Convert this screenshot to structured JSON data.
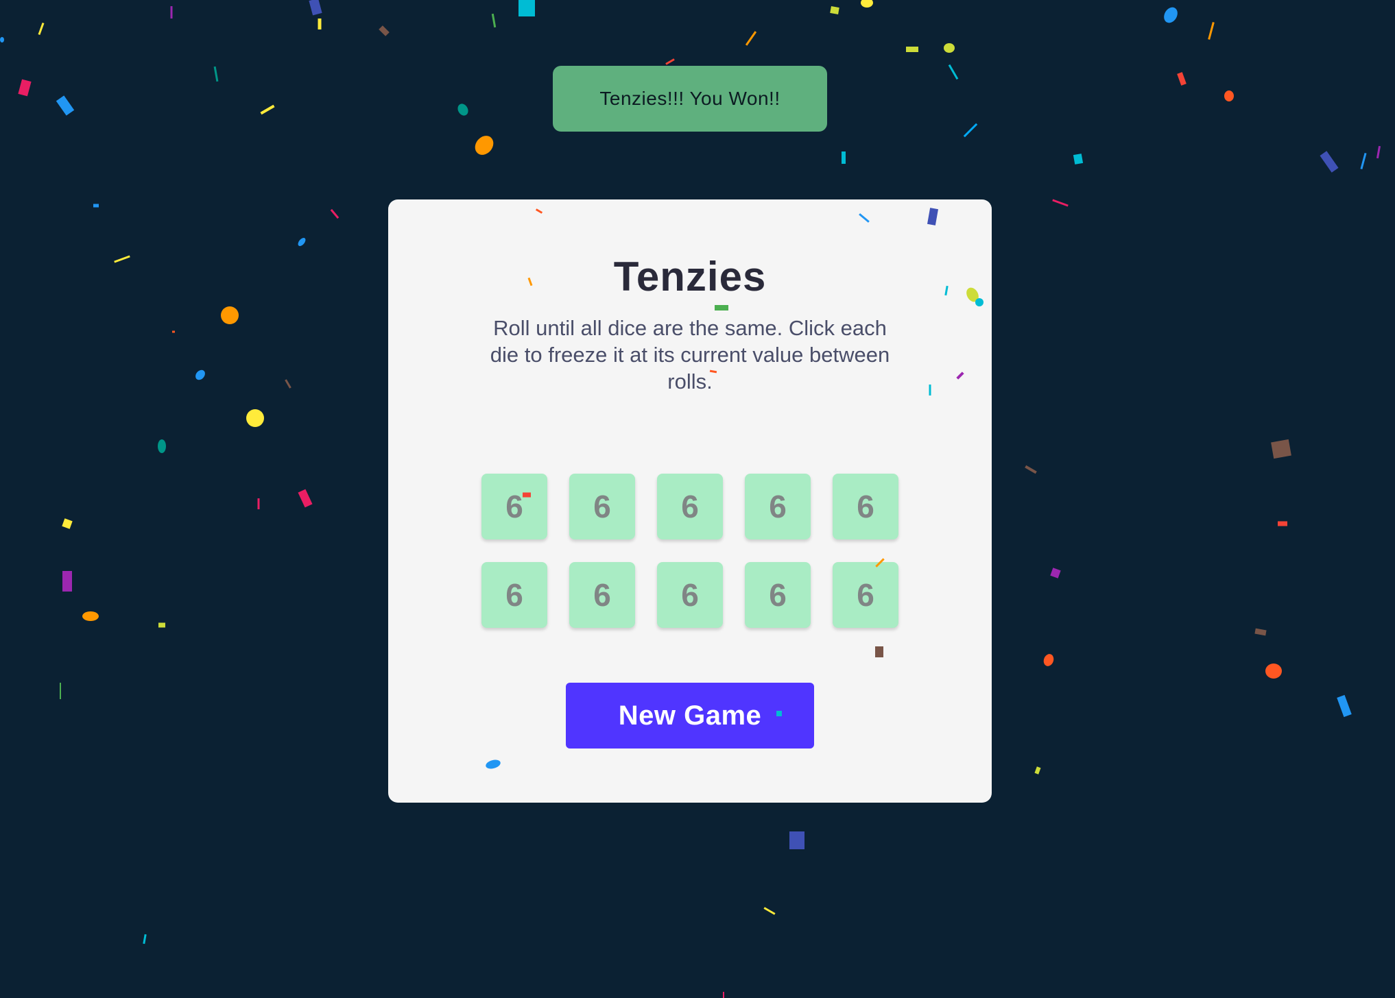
{
  "banner": {
    "text": "Tenzies!!! You Won!!"
  },
  "game": {
    "title": "Tenzies",
    "instructions": "Roll until all dice are the same. Click each die to freeze it at its current value between rolls.",
    "dice": [
      "6",
      "6",
      "6",
      "6",
      "6",
      "6",
      "6",
      "6",
      "6",
      "6"
    ],
    "new_game_label": "New Game"
  },
  "colors": {
    "background": "#0b2133",
    "banner": "#5fb07e",
    "card": "#f5f5f5",
    "die_held": "#a9ecc4",
    "button": "#5035ff"
  },
  "confetti": {
    "palette": [
      "#e91e63",
      "#2196f3",
      "#ffeb3b",
      "#ff9800",
      "#4caf50",
      "#00bcd4",
      "#9c27b0",
      "#3f51b5",
      "#795548",
      "#ff5722",
      "#cddc39",
      "#009688",
      "#673ab7",
      "#f44336",
      "#03a9f4"
    ]
  }
}
